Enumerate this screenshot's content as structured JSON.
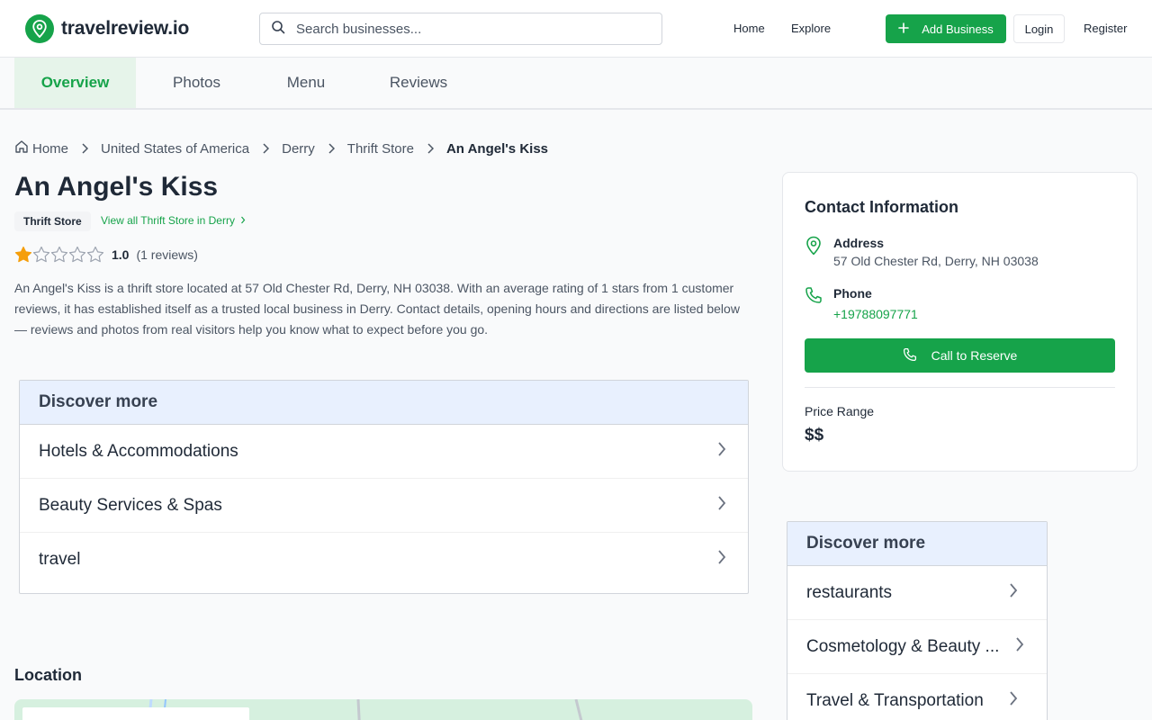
{
  "header": {
    "logo_text": "travelreview.io",
    "search_placeholder": "Search businesses...",
    "nav": {
      "home": "Home",
      "explore": "Explore"
    },
    "add_business": "Add Business",
    "login": "Login",
    "register": "Register"
  },
  "tabs": [
    {
      "label": "Overview",
      "active": true
    },
    {
      "label": "Photos",
      "active": false
    },
    {
      "label": "Menu",
      "active": false
    },
    {
      "label": "Reviews",
      "active": false
    }
  ],
  "breadcrumb": [
    "Home",
    "United States of America",
    "Derry",
    "Thrift Store",
    "An Angel's Kiss"
  ],
  "business": {
    "name": "An Angel's Kiss",
    "category": "Thrift Store",
    "view_all": "View all Thrift Store in Derry",
    "rating": "1.0",
    "rating_stars": 1,
    "rating_max": 5,
    "review_count": "(1 reviews)",
    "description": "An Angel's Kiss is a thrift store located at 57 Old Chester Rd, Derry, NH 03038. With an average rating of 1 stars from 1 customer reviews, it has established itself as a trusted local business in Derry. Contact details, opening hours and directions are listed below — reviews and photos from real visitors help you know what to expect before you go."
  },
  "discover_main": {
    "title": "Discover more",
    "items": [
      "Hotels & Accommodations",
      "Beauty Services & Spas",
      "travel"
    ]
  },
  "location": {
    "title": "Location"
  },
  "contact": {
    "title": "Contact Information",
    "address_label": "Address",
    "address": "57 Old Chester Rd, Derry, NH 03038",
    "phone_label": "Phone",
    "phone": "+19788097771",
    "call_button": "Call to Reserve",
    "price_label": "Price Range",
    "price": "$$"
  },
  "discover_side": {
    "title": "Discover more",
    "items": [
      "restaurants",
      "Cosmetology & Beauty ...",
      "Travel & Transportation"
    ]
  },
  "colors": {
    "accent": "#16a34a",
    "star": "#f59e0b",
    "discover_header": "#e8f0fe"
  }
}
